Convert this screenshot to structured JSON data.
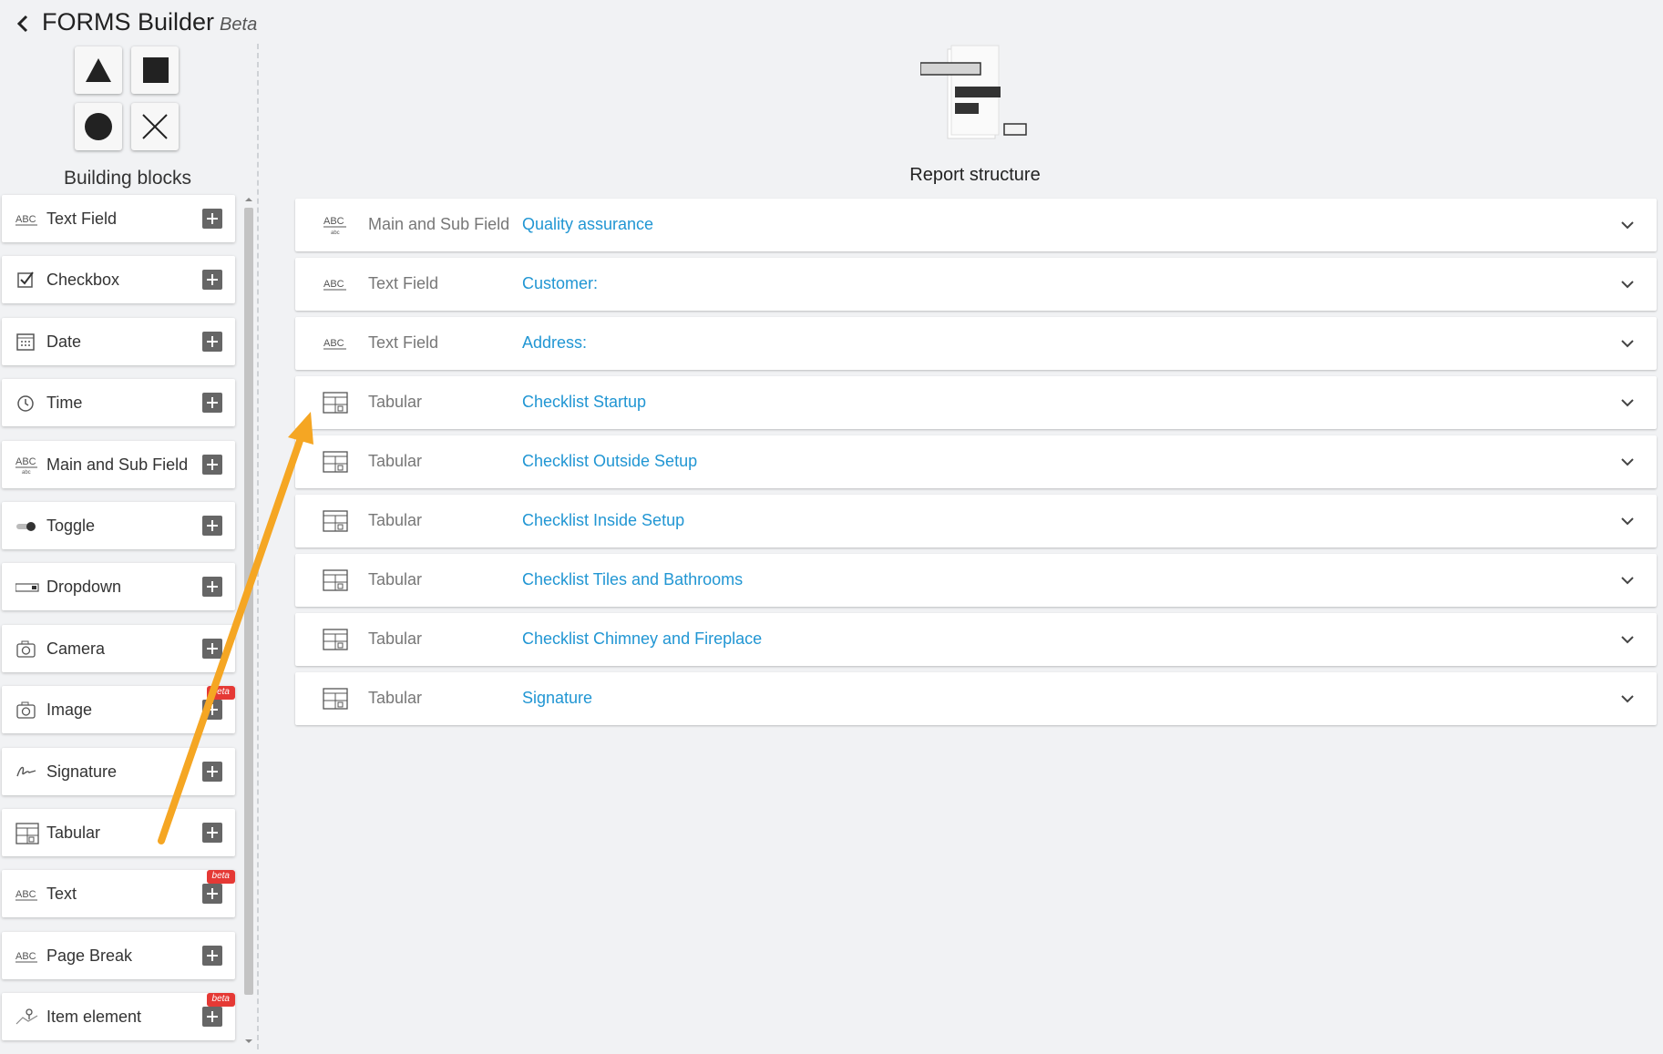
{
  "header": {
    "title": "FORMS Builder",
    "beta": "Beta"
  },
  "left": {
    "title": "Building blocks",
    "items": [
      {
        "label": "Text Field",
        "icon": "abc-icon",
        "badge": ""
      },
      {
        "label": "Checkbox",
        "icon": "checkbox-icon",
        "badge": ""
      },
      {
        "label": "Date",
        "icon": "calendar-icon",
        "badge": ""
      },
      {
        "label": "Time",
        "icon": "clock-icon",
        "badge": ""
      },
      {
        "label": "Main and Sub Field",
        "icon": "abc-sub-icon",
        "badge": ""
      },
      {
        "label": "Toggle",
        "icon": "toggle-icon",
        "badge": ""
      },
      {
        "label": "Dropdown",
        "icon": "dropdown-icon",
        "badge": ""
      },
      {
        "label": "Camera",
        "icon": "camera-icon",
        "badge": ""
      },
      {
        "label": "Image",
        "icon": "image-icon",
        "badge": "beta"
      },
      {
        "label": "Signature",
        "icon": "signature-icon",
        "badge": ""
      },
      {
        "label": "Tabular",
        "icon": "table-icon",
        "badge": ""
      },
      {
        "label": "Text",
        "icon": "abc-icon",
        "badge": "beta"
      },
      {
        "label": "Page Break",
        "icon": "abc-icon",
        "badge": ""
      },
      {
        "label": "Item element",
        "icon": "pin-icon",
        "badge": "beta"
      }
    ]
  },
  "main": {
    "title": "Report structure",
    "rows": [
      {
        "type": "Main and Sub Field",
        "name": "Quality assurance",
        "icon": "abc-sub-icon"
      },
      {
        "type": "Text Field",
        "name": "Customer:",
        "icon": "abc-icon"
      },
      {
        "type": "Text Field",
        "name": "Address:",
        "icon": "abc-icon"
      },
      {
        "type": "Tabular",
        "name": "Checklist Startup",
        "icon": "table-icon"
      },
      {
        "type": "Tabular",
        "name": "Checklist Outside Setup",
        "icon": "table-icon"
      },
      {
        "type": "Tabular",
        "name": "Checklist Inside Setup",
        "icon": "table-icon"
      },
      {
        "type": "Tabular",
        "name": "Checklist Tiles and Bathrooms",
        "icon": "table-icon"
      },
      {
        "type": "Tabular",
        "name": "Checklist Chimney and Fireplace",
        "icon": "table-icon"
      },
      {
        "type": "Tabular",
        "name": "Signature",
        "icon": "table-icon"
      }
    ]
  },
  "colors": {
    "accent": "#2196d3",
    "arrow": "#f5a623",
    "badge": "#e53935",
    "background": "#f1f2f4"
  }
}
